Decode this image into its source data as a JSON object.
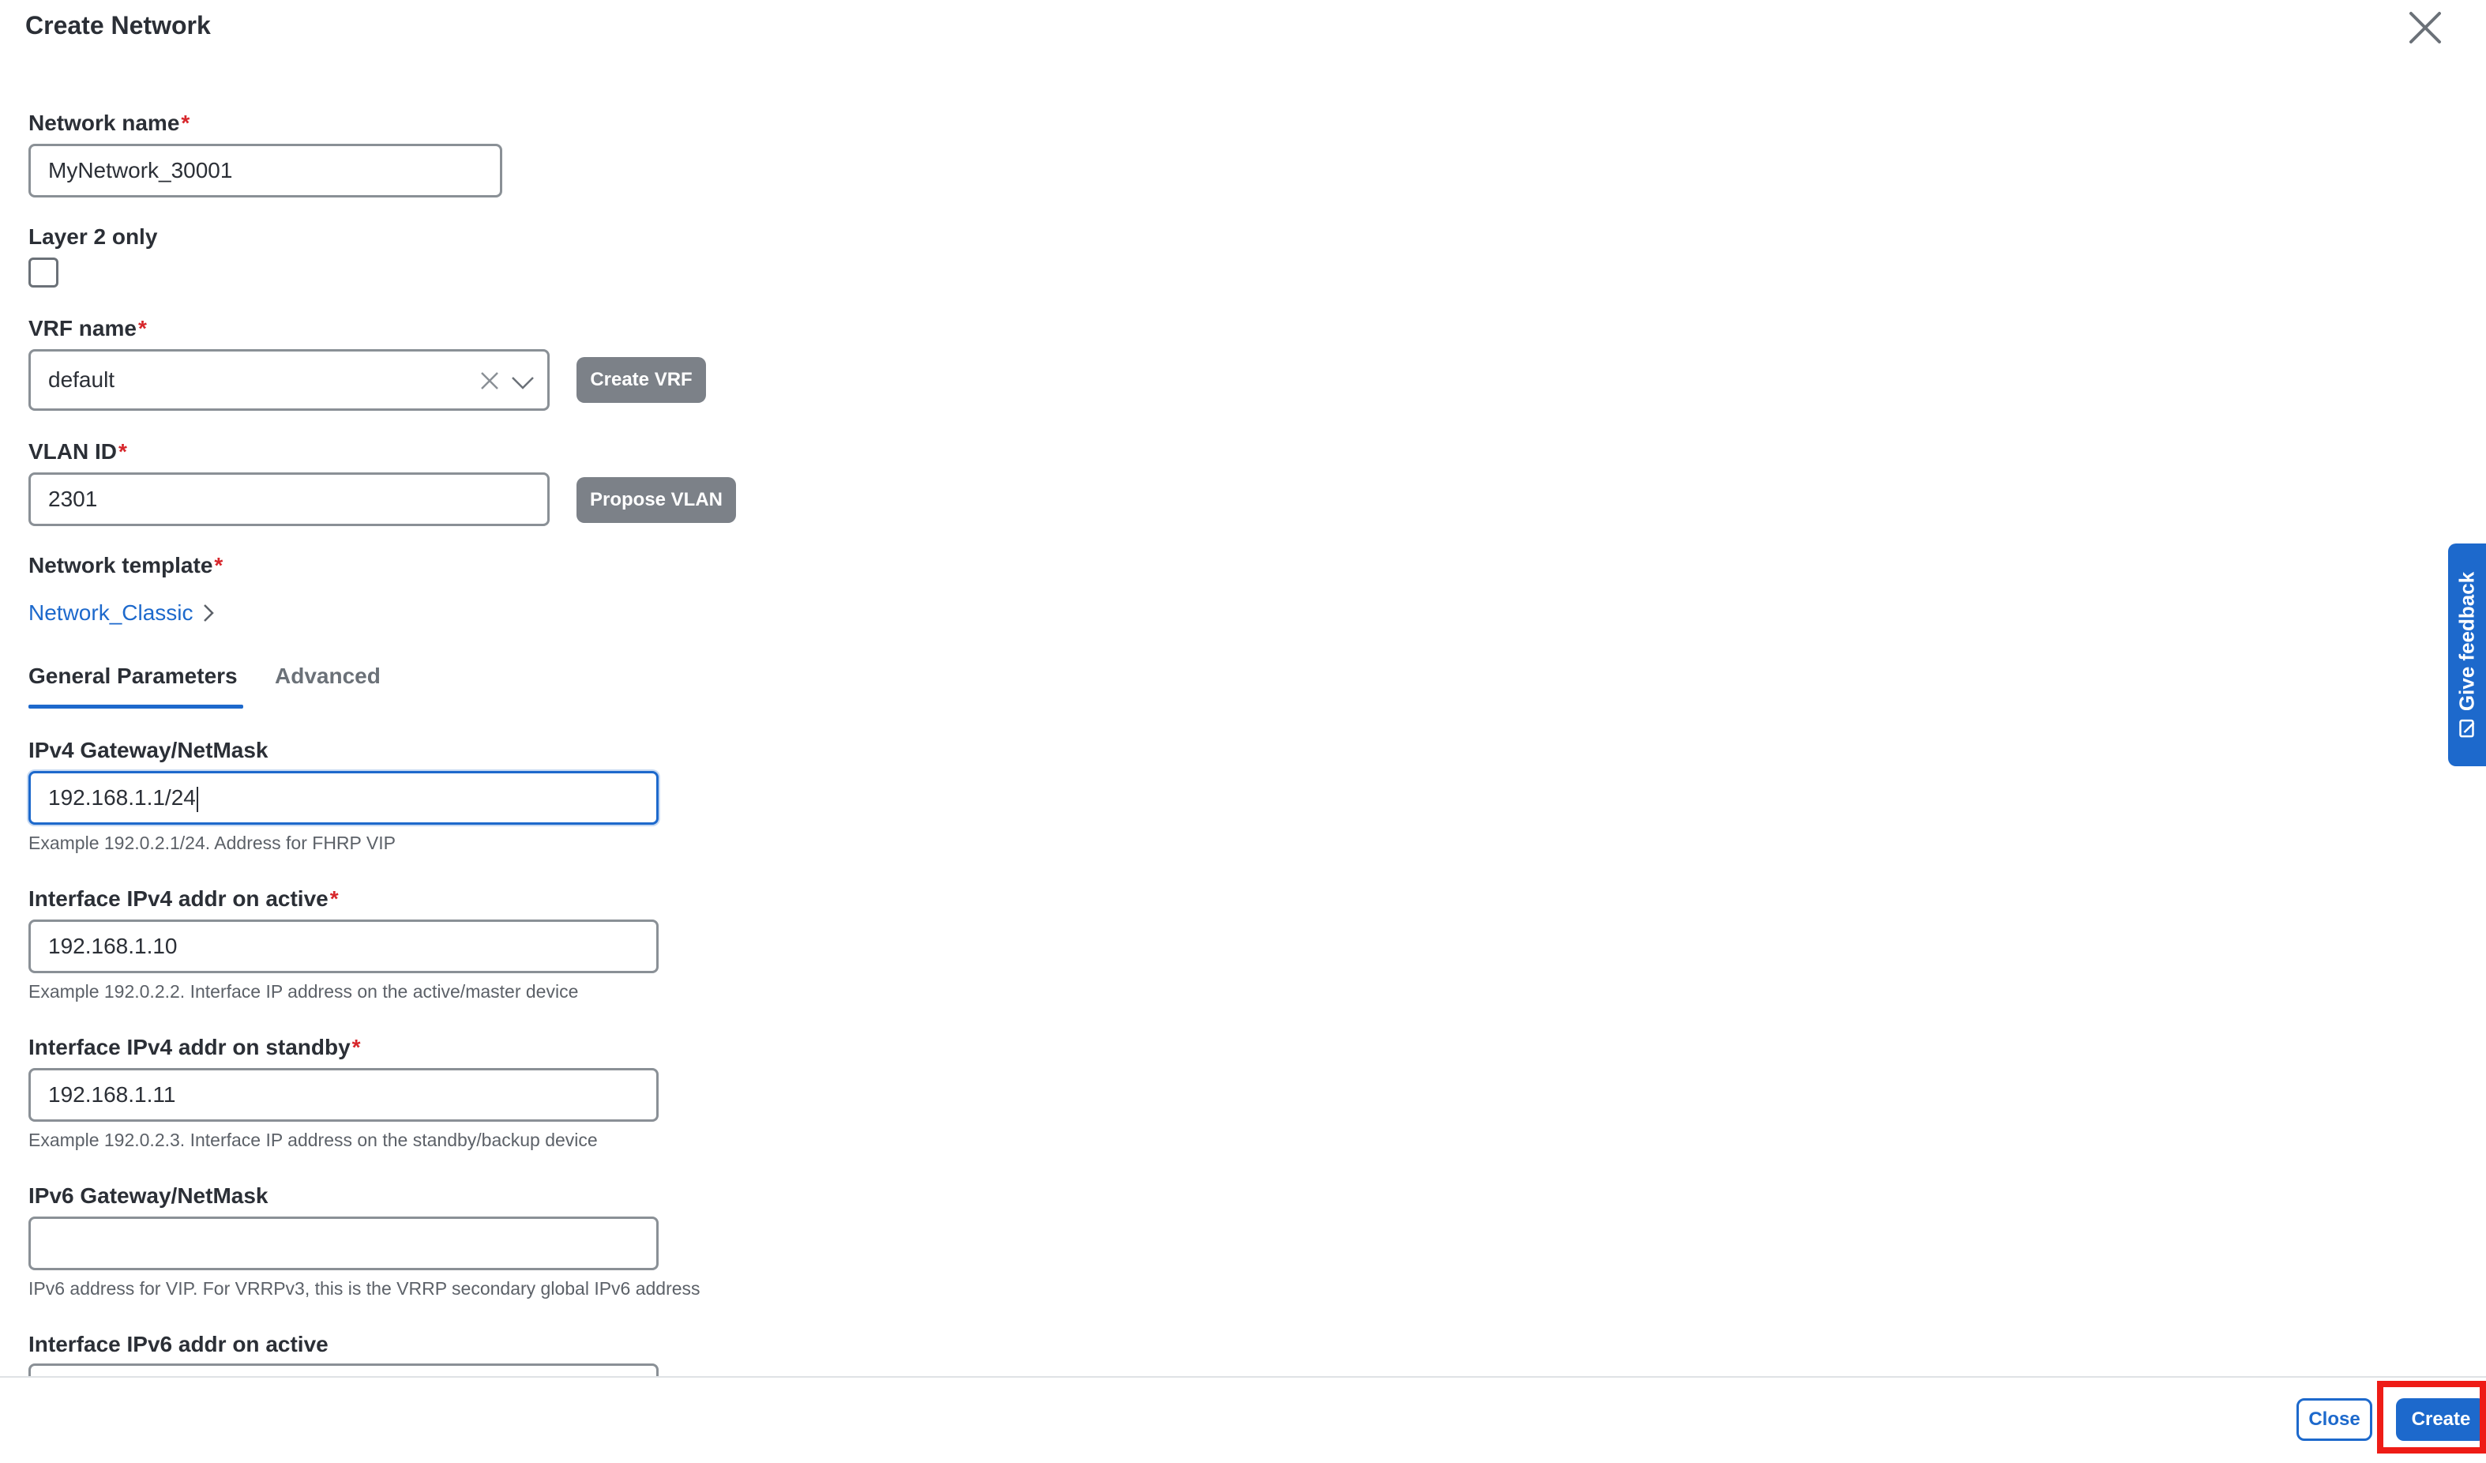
{
  "dialog": {
    "title": "Create Network"
  },
  "fields": {
    "network_name": {
      "label": "Network name",
      "required_mark": "*",
      "value": "MyNetwork_30001"
    },
    "layer2_only": {
      "label": "Layer 2 only",
      "checked": false
    },
    "vrf_name": {
      "label": "VRF name",
      "required_mark": "*",
      "value": "default",
      "button": "Create VRF"
    },
    "vlan_id": {
      "label": "VLAN ID",
      "required_mark": "*",
      "value": "2301",
      "button": "Propose VLAN"
    },
    "network_template": {
      "label": "Network template",
      "required_mark": "*",
      "link": "Network_Classic"
    }
  },
  "tabs": [
    {
      "label": "General Parameters",
      "active": true
    },
    {
      "label": "Advanced",
      "active": false
    }
  ],
  "general": {
    "ipv4_gateway": {
      "label": "IPv4 Gateway/NetMask",
      "value": "192.168.1.1/24",
      "helper": "Example 192.0.2.1/24. Address for FHRP VIP"
    },
    "ipv4_active": {
      "label": "Interface IPv4 addr on active",
      "required_mark": "*",
      "value": "192.168.1.10",
      "helper": "Example 192.0.2.2. Interface IP address on the active/master device"
    },
    "ipv4_standby": {
      "label": "Interface IPv4 addr on standby",
      "required_mark": "*",
      "value": "192.168.1.11",
      "helper": "Example 192.0.2.3. Interface IP address on the standby/backup device"
    },
    "ipv6_gateway": {
      "label": "IPv6 Gateway/NetMask",
      "value": "",
      "helper": "IPv6 address for VIP. For VRRPv3, this is the VRRP secondary global IPv6 address"
    },
    "ipv6_active": {
      "label": "Interface IPv6 addr on active"
    }
  },
  "footer": {
    "close_label": "Close",
    "create_label": "Create"
  },
  "feedback": {
    "label": "Give feedback"
  },
  "colors": {
    "accent": "#1d69cc",
    "required": "#d7262b",
    "highlight": "#ee1c16",
    "gray_button": "#7c8188"
  },
  "icons": {
    "dialog_close": "close-icon",
    "select_clear": "clear-icon",
    "select_open": "chevron-down-icon",
    "template_link": "chevron-right-icon",
    "feedback": "feedback-icon"
  }
}
